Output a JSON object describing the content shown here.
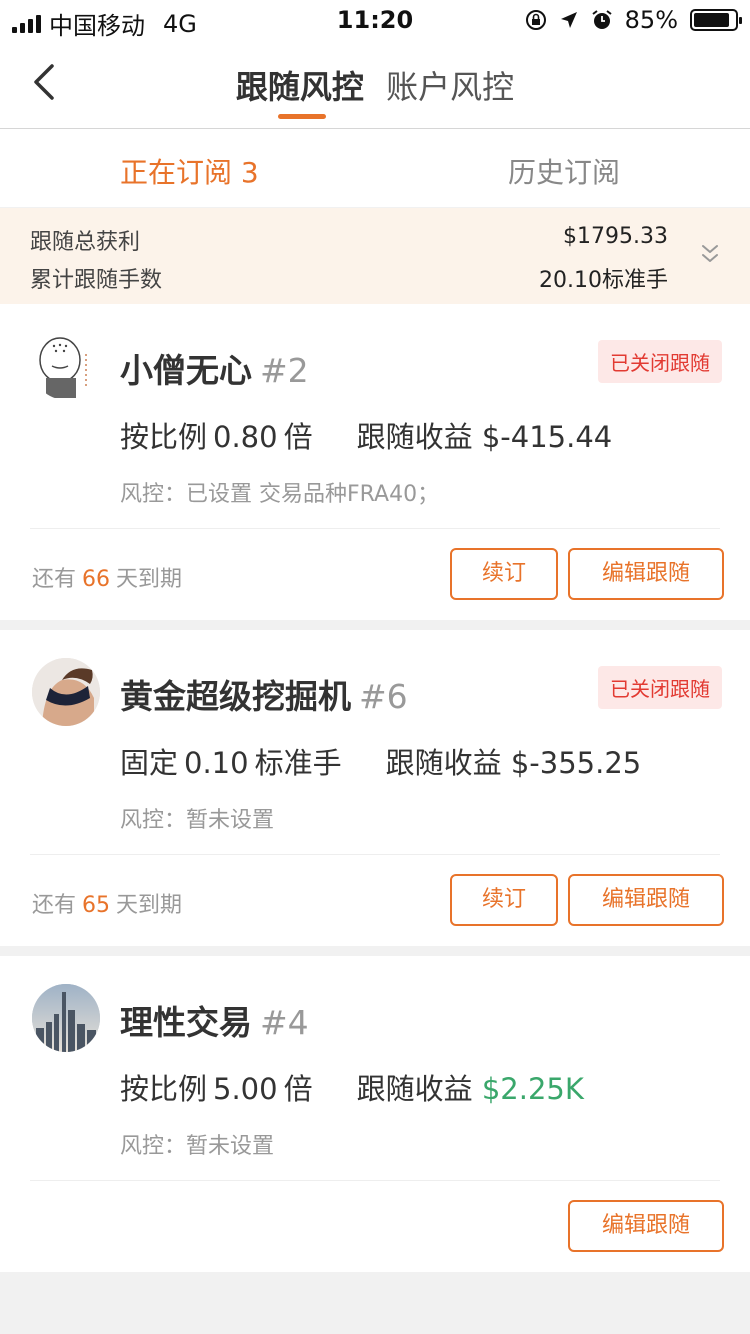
{
  "status_bar": {
    "carrier": "中国移动",
    "network": "4G",
    "time": "11:20",
    "battery": "85%"
  },
  "nav": {
    "tabs": [
      {
        "label": "跟随风控",
        "active": true
      },
      {
        "label": "账户风控",
        "active": false
      }
    ]
  },
  "subtabs": {
    "current": "正在订阅 3",
    "history": "历史订阅"
  },
  "summary": {
    "profit_label": "跟随总获利",
    "profit_value": "$1795.33",
    "lots_label": "累计跟随手数",
    "lots_value": "20.10标准手"
  },
  "cards": [
    {
      "name": "小僧无心",
      "num": "#2",
      "badge": "已关闭跟随",
      "mode": "按比例",
      "mode_value": "0.80",
      "mode_unit": "倍",
      "profit_label": "跟随收益",
      "profit": "$-415.44",
      "risk": "风控：已设置 交易品种FRA40；",
      "expiry_prefix": "还有",
      "expiry_days": "66",
      "expiry_suffix": "天到期",
      "renew": "续订",
      "edit": "编辑跟随"
    },
    {
      "name": "黄金超级挖掘机",
      "num": "#6",
      "badge": "已关闭跟随",
      "mode": "固定",
      "mode_value": "0.10",
      "mode_unit": "标准手",
      "profit_label": "跟随收益",
      "profit": "$-355.25",
      "risk": "风控：暂未设置",
      "expiry_prefix": "还有",
      "expiry_days": "65",
      "expiry_suffix": "天到期",
      "renew": "续订",
      "edit": "编辑跟随"
    },
    {
      "name": "理性交易",
      "num": "#4",
      "mode": "按比例",
      "mode_value": "5.00",
      "mode_unit": "倍",
      "profit_label": "跟随收益",
      "profit": "$2.25K",
      "risk": "风控：暂未设置",
      "edit": "编辑跟随"
    }
  ],
  "colors": {
    "accent": "#e8732a",
    "positive": "#3aa76b",
    "badge_text": "#e23a32",
    "badge_bg": "#fde8e7",
    "summary_bg": "#fcf3ea"
  },
  "icons": {
    "back": "chevron-left-icon",
    "expand": "double-chevron-down-icon"
  }
}
